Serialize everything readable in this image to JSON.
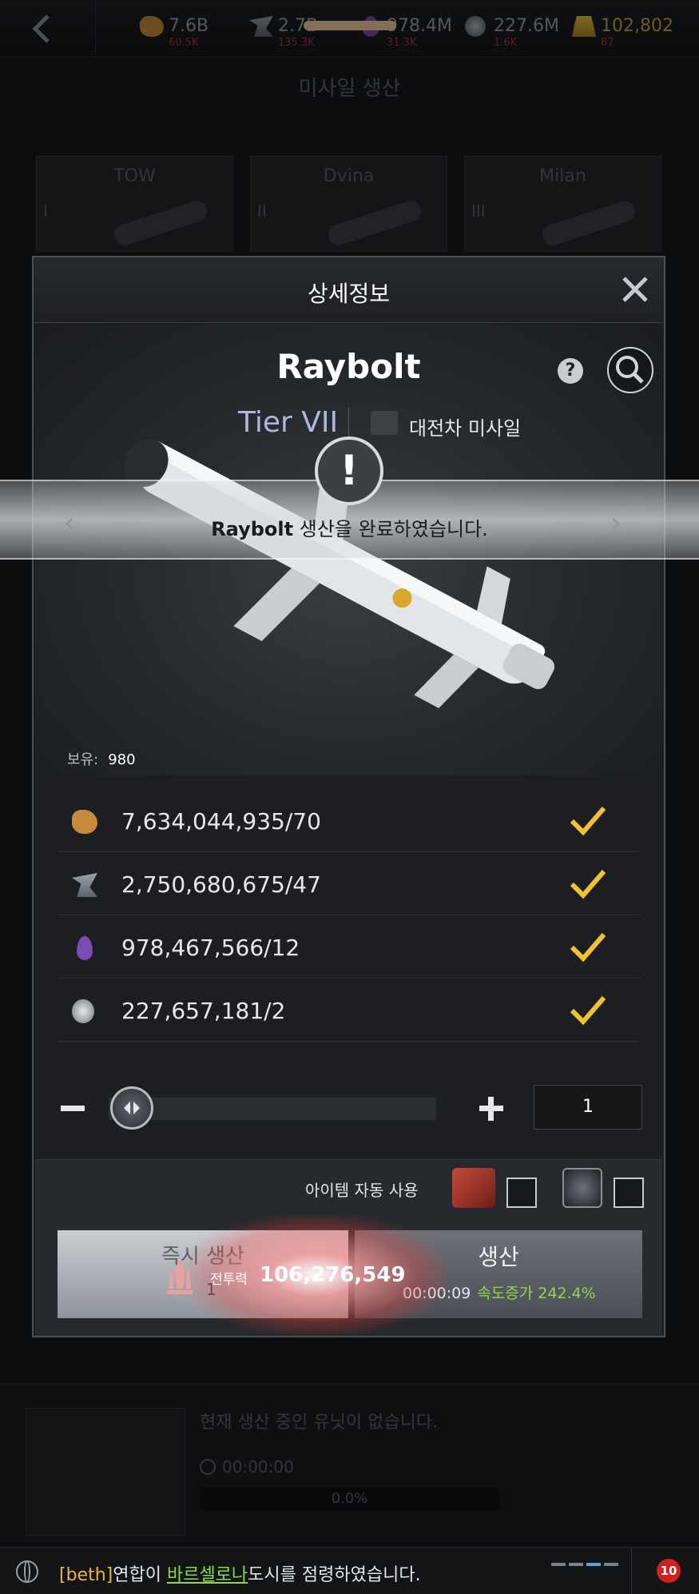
{
  "topbar": {
    "resources": [
      {
        "name": "food",
        "value": "7.6B",
        "sub": "60.5K",
        "icon": "bread-icon"
      },
      {
        "name": "steel",
        "value": "2.7B",
        "sub": "135.3K",
        "icon": "steel-icon"
      },
      {
        "name": "oil",
        "value": "978.4M",
        "sub": "31.3K",
        "icon": "oil-drop-icon"
      },
      {
        "name": "mineral",
        "value": "227.6M",
        "sub": "1.6K",
        "icon": "mineral-icon"
      },
      {
        "name": "gold",
        "value": "102,802",
        "sub": "87",
        "icon": "gold-bars-icon"
      }
    ]
  },
  "background_screen": {
    "title": "미사일 생산",
    "cards": [
      {
        "name": "TOW",
        "tier": "I"
      },
      {
        "name": "Dvina",
        "tier": "II"
      },
      {
        "name": "Milan",
        "tier": "III"
      }
    ],
    "queue_message": "현재 생산 중인 유닛이 없습니다.",
    "queue_timer": "00:00:00",
    "queue_progress": "0.0%"
  },
  "modal": {
    "title": "상세정보",
    "unit_name": "Raybolt",
    "tier": "Tier VII",
    "unit_type": "대전차 미사일",
    "owned_label": "보유:",
    "owned_value": "980",
    "costs": [
      {
        "icon": "bread-icon",
        "amount": "7,634,044,935/70",
        "met": true
      },
      {
        "icon": "steel-icon",
        "amount": "2,750,680,675/47",
        "met": true
      },
      {
        "icon": "oil-drop-icon",
        "amount": "978,467,566/12",
        "met": true
      },
      {
        "icon": "mineral-icon",
        "amount": "227,657,181/2",
        "met": true
      }
    ],
    "quantity": "1",
    "quantity_fraction": 0.0,
    "auto_use_label": "아이템 자동 사용",
    "instant_button": {
      "label": "즉시 생산",
      "count": "1"
    },
    "produce_button": {
      "label": "생산",
      "time": "00:00:09",
      "speed": "속도증가 242.4%"
    }
  },
  "toast": {
    "unit": "Raybolt",
    "message": " 생산을 완료하였습니다."
  },
  "combat_power": {
    "label": "전투력",
    "value": "106,276,549"
  },
  "chat": {
    "alliance": "[beth]",
    "text1": "연합이 ",
    "city": "바르셀로나",
    "text2": "도시를 점령하였습니다."
  },
  "mail_count": "10",
  "colors": {
    "accent_check": "#f2c230",
    "tier": "#aab9dd",
    "speed_bonus": "#8fd84d",
    "alliance": "#e8b63c",
    "badge": "#d02020"
  }
}
